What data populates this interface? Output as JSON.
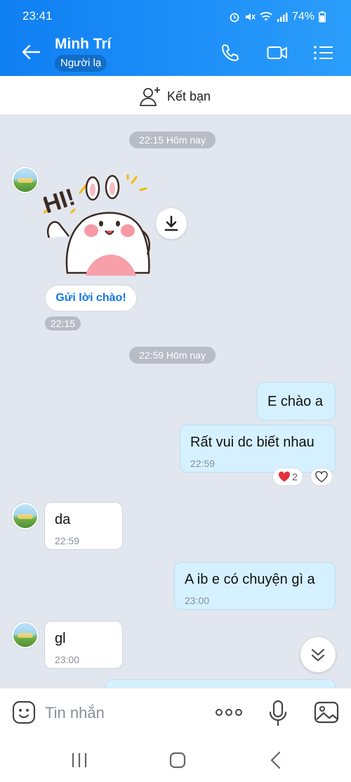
{
  "status_bar": {
    "time": "23:41",
    "battery_percent": "74%"
  },
  "header": {
    "contact_name": "Minh Trí",
    "contact_tag": "Người lạ"
  },
  "add_friend": {
    "label": "Kết bạn"
  },
  "messages": {
    "date_1": "22:15 Hôm nay",
    "greeting_button": "Gửi lời chào!",
    "sticker_time": "22:15",
    "date_2": "22:59 Hôm nay",
    "out_1": "E chào a",
    "out_2": "Rất vui dc biết nhau",
    "out_2_time": "22:59",
    "out_2_reaction_count": "2",
    "in_1": "da",
    "in_1_time": "22:59",
    "out_3": "A ib e có chuyện gì a",
    "out_3_time": "23:00",
    "in_2": "gl",
    "in_2_time": "23:00"
  },
  "composer": {
    "placeholder": "Tin nhắn"
  },
  "colors": {
    "header_blue": "#1a8bf6",
    "chat_bg": "#e2e6ee",
    "out_bubble": "#d5f1ff",
    "in_bubble": "#ffffff"
  }
}
